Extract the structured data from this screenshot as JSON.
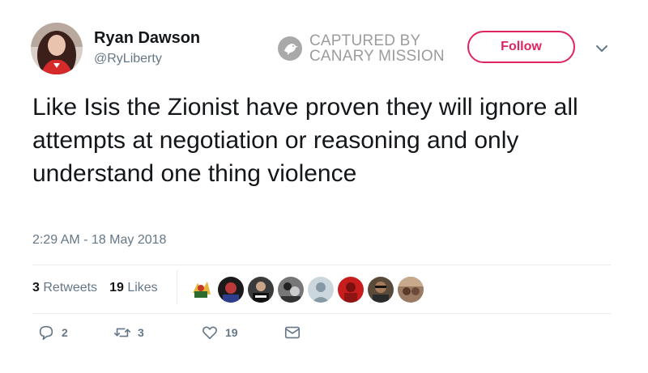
{
  "user": {
    "name": "Ryan Dawson",
    "handle": "@RyLiberty"
  },
  "watermark": {
    "line1": "CAPTURED BY",
    "line2": "CANARY MISSION"
  },
  "header": {
    "follow_label": "Follow"
  },
  "tweet": {
    "text": "Like Isis the Zionist have proven they will ignore all attempts at negotiation or reasoning and only understand one thing violence",
    "timestamp": "2:29 AM - 18 May 2018"
  },
  "stats": {
    "retweets_count": "3",
    "retweets_label": "Retweets",
    "likes_count": "19",
    "likes_label": "Likes"
  },
  "actions": {
    "reply_count": "2",
    "retweet_count": "3",
    "like_count": "19"
  },
  "colors": {
    "accent": "#e0245e",
    "secondary_text": "#657786",
    "divider": "#e6ecf0"
  },
  "icons": [
    "reply-icon",
    "retweet-icon",
    "heart-icon",
    "message-icon",
    "chevron-down-icon",
    "canary-mission-logo"
  ]
}
